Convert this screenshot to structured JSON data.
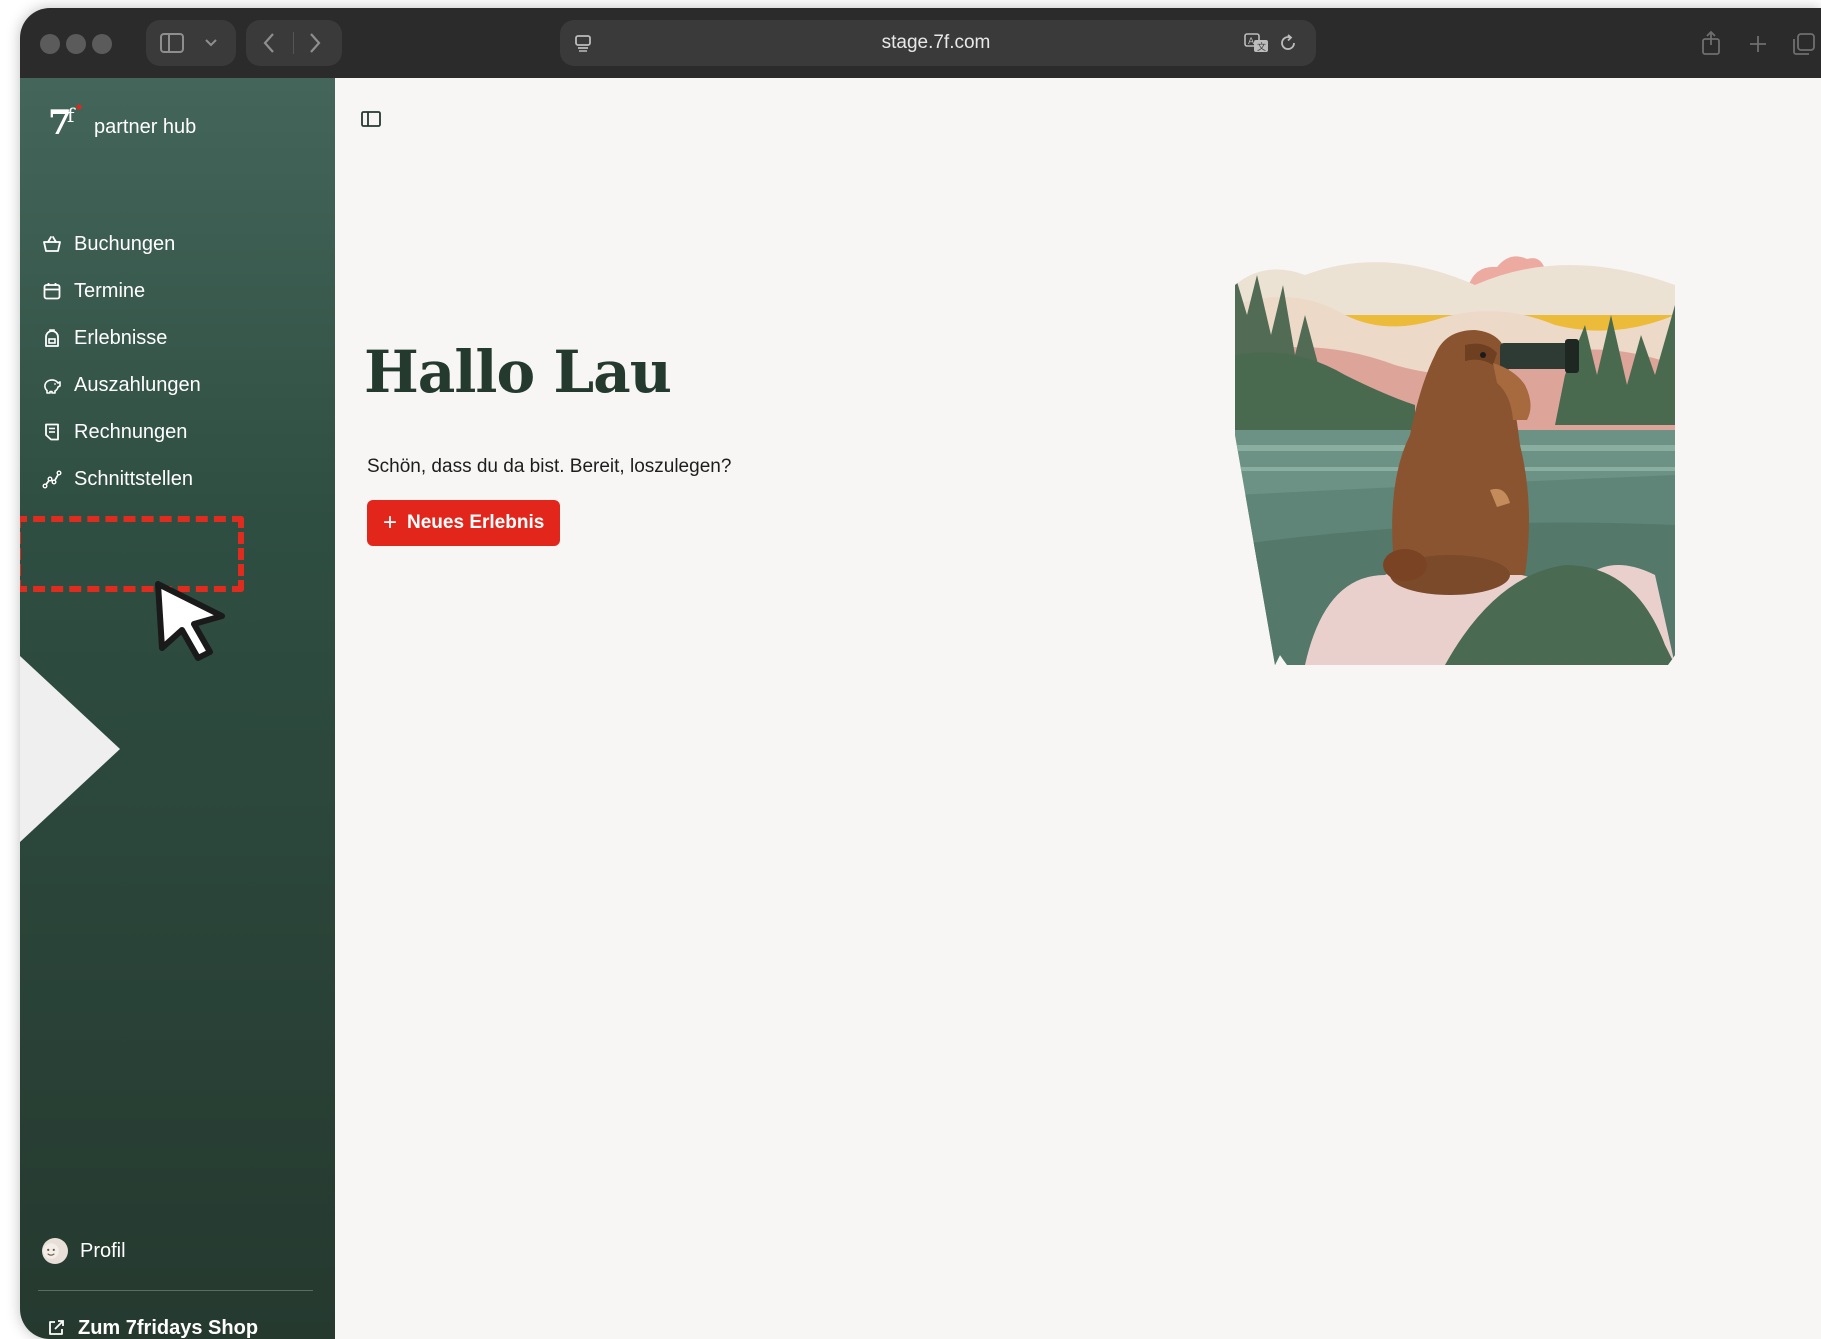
{
  "browser": {
    "url": "stage.7f.com"
  },
  "sidebar": {
    "brand": "partner hub",
    "items": [
      {
        "label": "Buchungen",
        "icon": "shopping-basket-icon"
      },
      {
        "label": "Termine",
        "icon": "calendar-icon"
      },
      {
        "label": "Erlebnisse",
        "icon": "backpack-icon"
      },
      {
        "label": "Auszahlungen",
        "icon": "piggy-bank-icon"
      },
      {
        "label": "Rechnungen",
        "icon": "receipt-icon"
      },
      {
        "label": "Schnittstellen",
        "icon": "integrations-icon"
      }
    ],
    "profile_label": "Profil",
    "shop_link": "Zum 7fridays Shop"
  },
  "main": {
    "greeting": "Hallo Lau",
    "subtitle": "Schön, dass du da bist. Bereit, loszulegen?",
    "cta_label": "Neues Erlebnis"
  },
  "colors": {
    "sidebar_top": "#44665a",
    "sidebar_bottom": "#25392f",
    "accent": "#e3261c",
    "heading": "#253a2f",
    "background": "#f7f6f4",
    "highlight": "#e02b1f"
  }
}
